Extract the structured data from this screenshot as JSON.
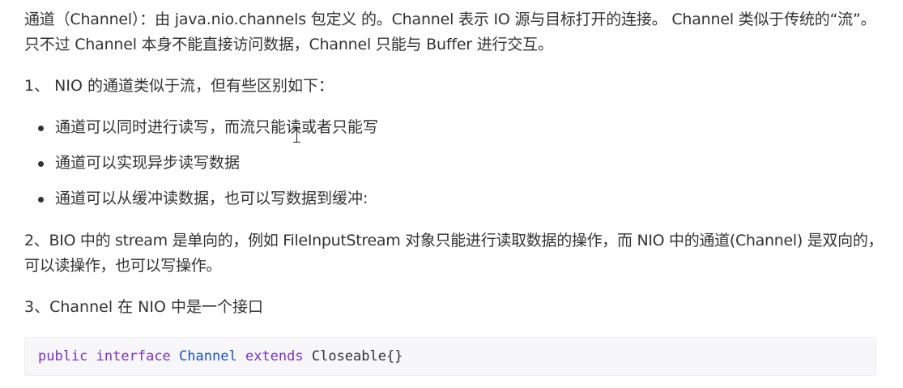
{
  "intro": {
    "text": "通道（Channel）：由 java.nio.channels 包定义 的。Channel 表示 IO 源与目标打开的连接。 Channel 类似于传统的“流”。只不过 Channel 本身不能直接访问数据，Channel 只能与 Buffer 进行交互。"
  },
  "point1": {
    "text": "1、 NIO 的通道类似于流，但有些区别如下："
  },
  "bullets": [
    "通道可以同时进行读写，而流只能读或者只能写",
    "通道可以实现异步读写数据",
    "通道可以从缓冲读数据，也可以写数据到缓冲:"
  ],
  "point2": {
    "text": "2、BIO 中的 stream 是单向的，例如 FileInputStream 对象只能进行读取数据的操作，而 NIO 中的通道(Channel) 是双向的，可以读操作，也可以写操作。"
  },
  "point3": {
    "text": "3、Channel 在 NIO 中是一个接口"
  },
  "code": {
    "kw_public": "public",
    "kw_interface": "interface",
    "type_name": "Channel",
    "kw_extends": "extends",
    "rest": "Closeable{}"
  },
  "colors": {
    "text": "#333333",
    "keyword": "#7b30d0",
    "type": "#1a4fd8",
    "code_bg": "#f7f7f9"
  },
  "icons": {
    "cursor": "text-cursor-icon"
  }
}
